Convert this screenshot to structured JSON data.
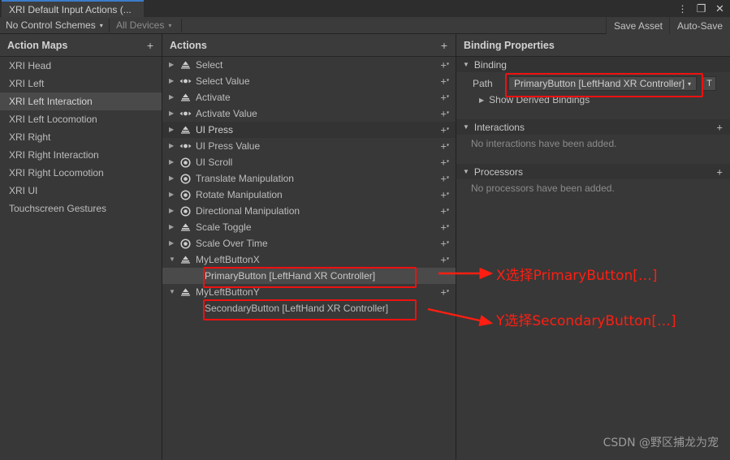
{
  "window": {
    "tab_title": "XRI Default Input Actions (...",
    "kebab_icon": "⋮",
    "maximize_icon": "❐",
    "close_icon": "✕"
  },
  "toolbar": {
    "control_schemes": "No Control Schemes",
    "devices": "All Devices",
    "caret": "▾",
    "save_asset": "Save Asset",
    "auto_save": "Auto-Save"
  },
  "action_maps": {
    "title": "Action Maps",
    "add_icon": "+",
    "items": [
      {
        "label": "XRI Head",
        "selected": false
      },
      {
        "label": "XRI Left",
        "selected": false
      },
      {
        "label": "XRI Left Interaction",
        "selected": true
      },
      {
        "label": "XRI Left Locomotion",
        "selected": false
      },
      {
        "label": "XRI Right",
        "selected": false
      },
      {
        "label": "XRI Right Interaction",
        "selected": false
      },
      {
        "label": "XRI Right Locomotion",
        "selected": false
      },
      {
        "label": "XRI UI",
        "selected": false
      },
      {
        "label": "Touchscreen Gestures",
        "selected": false
      }
    ]
  },
  "actions": {
    "title": "Actions",
    "add_icon": "+",
    "collapsed_twisty": "▶",
    "expanded_twisty": "▼",
    "add_binding_icon": "+",
    "add_binding_caret": "▾",
    "items": [
      {
        "label": "Select",
        "icon": "button-action-icon",
        "expanded": false,
        "hover": false
      },
      {
        "label": "Select Value",
        "icon": "axis-action-icon",
        "expanded": false,
        "hover": false
      },
      {
        "label": "Activate",
        "icon": "button-action-icon",
        "expanded": false,
        "hover": false
      },
      {
        "label": "Activate Value",
        "icon": "axis-action-icon",
        "expanded": false,
        "hover": false
      },
      {
        "label": "UI Press",
        "icon": "button-action-icon",
        "expanded": false,
        "hover": true
      },
      {
        "label": "UI Press Value",
        "icon": "axis-action-icon",
        "expanded": false,
        "hover": false
      },
      {
        "label": "UI Scroll",
        "icon": "value-action-icon",
        "expanded": false,
        "hover": false
      },
      {
        "label": "Translate Manipulation",
        "icon": "value-action-icon",
        "expanded": false,
        "hover": false
      },
      {
        "label": "Rotate Manipulation",
        "icon": "value-action-icon",
        "expanded": false,
        "hover": false
      },
      {
        "label": "Directional Manipulation",
        "icon": "value-action-icon",
        "expanded": false,
        "hover": false
      },
      {
        "label": "Scale Toggle",
        "icon": "button-action-icon",
        "expanded": false,
        "hover": false
      },
      {
        "label": "Scale Over Time",
        "icon": "value-action-icon",
        "expanded": false,
        "hover": false
      },
      {
        "label": "MyLeftButtonX",
        "icon": "button-action-icon",
        "expanded": true,
        "hover": false,
        "binding": {
          "label": "PrimaryButton [LeftHand XR Controller]",
          "selected": true,
          "highlighted": true
        }
      },
      {
        "label": "MyLeftButtonY",
        "icon": "button-action-icon",
        "expanded": true,
        "hover": false,
        "binding": {
          "label": "SecondaryButton [LeftHand XR Controller]",
          "selected": false,
          "highlighted": true
        }
      }
    ]
  },
  "binding_properties": {
    "title": "Binding Properties",
    "expanded_twisty": "▼",
    "collapsed_twisty": "▶",
    "binding_section": {
      "label": "Binding",
      "path_label": "Path",
      "path_value": "PrimaryButton [LeftHand XR Controller]",
      "path_caret": "▾",
      "path_highlighted": true,
      "t_button": "T",
      "derived_label": "Show Derived Bindings"
    },
    "interactions_section": {
      "label": "Interactions",
      "add_icon": "+",
      "empty_text": "No interactions have been added."
    },
    "processors_section": {
      "label": "Processors",
      "add_icon": "+",
      "empty_text": "No processors have been added."
    }
  },
  "annotations": {
    "color": "#ff1e11",
    "items": [
      {
        "text": "X选择PrimaryButton[…]"
      },
      {
        "text": "Y选择SecondaryButton[…]"
      }
    ]
  },
  "watermark": "CSDN @野区捕龙为宠"
}
